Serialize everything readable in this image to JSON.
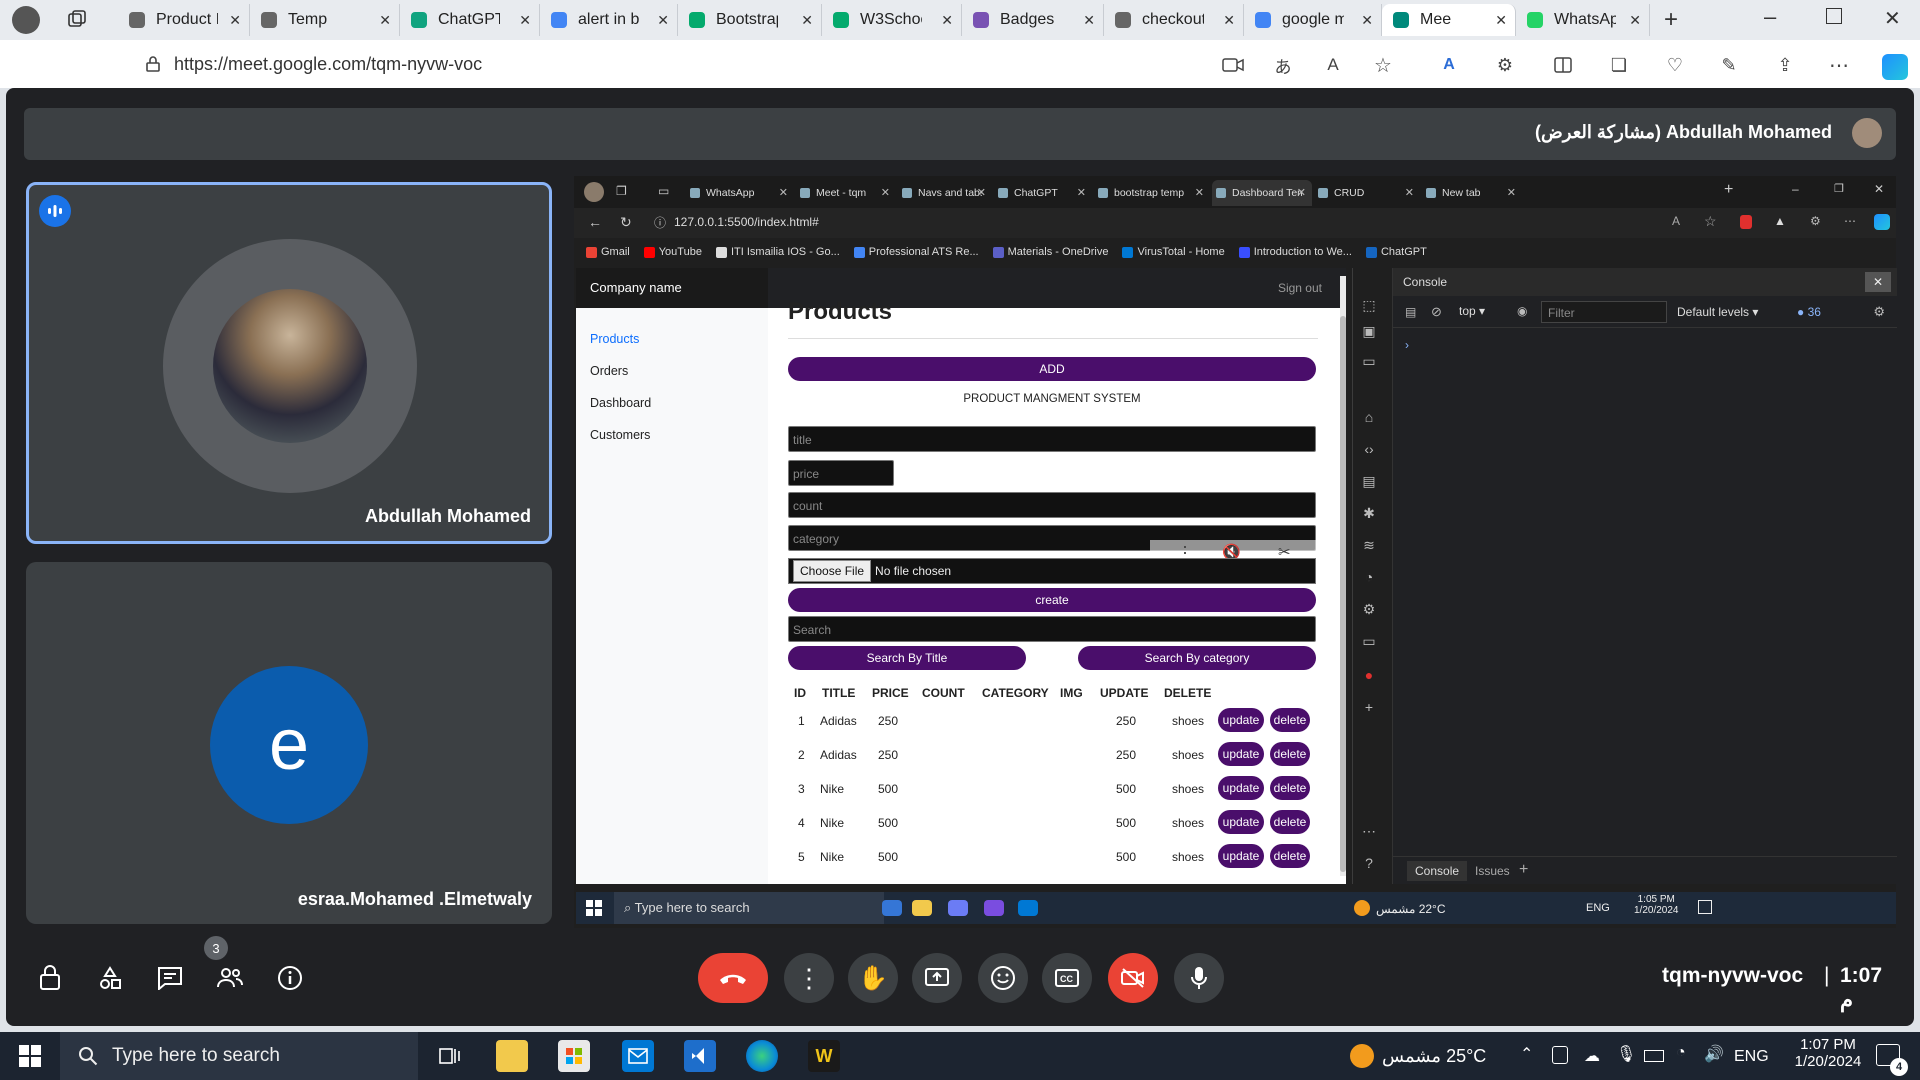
{
  "browser": {
    "tabs": [
      {
        "label": "Product I",
        "icon": "document-icon",
        "active": false
      },
      {
        "label": "Temp",
        "icon": "document-icon",
        "active": false
      },
      {
        "label": "ChatGPT",
        "icon": "chatgpt-icon",
        "active": false
      },
      {
        "label": "alert in b",
        "icon": "search-icon",
        "active": false
      },
      {
        "label": "Bootstrap",
        "icon": "w3schools-icon",
        "active": false
      },
      {
        "label": "W3Schoo",
        "icon": "w3schools-icon",
        "active": false
      },
      {
        "label": "Badges",
        "icon": "bootstrap-icon",
        "active": false
      },
      {
        "label": "checkout",
        "icon": "document-icon",
        "active": false
      },
      {
        "label": "google m",
        "icon": "search-icon",
        "active": false
      },
      {
        "label": "Mee",
        "icon": "meet-icon",
        "active": true
      },
      {
        "label": "WhatsAp",
        "icon": "whatsapp-icon",
        "active": false
      }
    ],
    "url": "https://meet.google.com/tqm-nyvw-voc"
  },
  "meet": {
    "presenter_title": "Abdullah Mohamed (مشاركة العرض)",
    "participants": [
      {
        "name": "Abdullah Mohamed",
        "speaking": true
      },
      {
        "name": "esraa.Mohamed .Elmetwaly",
        "initial": "e",
        "avatar_color": "#0b5cad"
      }
    ],
    "people_count": "3",
    "meeting_code": "tqm-nyvw-voc",
    "time": "1:07 م",
    "end_call_color": "#ea4335"
  },
  "shared": {
    "tabs": [
      {
        "label": "WhatsApp"
      },
      {
        "label": "Meet - tqm"
      },
      {
        "label": "Navs and tabs -"
      },
      {
        "label": "ChatGPT"
      },
      {
        "label": "bootstrap temp"
      },
      {
        "label": "Dashboard Tem"
      },
      {
        "label": "CRUD"
      },
      {
        "label": "New tab"
      }
    ],
    "url": "127.0.0.1:5500/index.html#",
    "bookmarks": [
      "Gmail",
      "YouTube",
      "ITI Ismailia IOS - Go...",
      "Professional ATS Re...",
      "Materials - OneDrive",
      "VirusTotal - Home",
      "Introduction to We...",
      "ChatGPT"
    ],
    "app": {
      "company": "Company name",
      "signout": "Sign out",
      "nav": [
        "Products",
        "Orders",
        "Dashboard",
        "Customers"
      ],
      "page_title": "Products",
      "add_label": "ADD",
      "subtitle": "PRODUCT MANGMENT SYSTEM",
      "placeholders": {
        "title": "title",
        "price": "price",
        "count": "count",
        "category": "category",
        "search": "Search"
      },
      "file_button": "Choose File",
      "file_status": "No file chosen",
      "create_label": "create",
      "search_title_label": "Search By Title",
      "search_category_label": "Search By category",
      "columns": [
        "ID",
        "TITLE",
        "PRICE",
        "COUNT",
        "CATEGORY",
        "IMG",
        "UPDATE",
        "DELETE"
      ],
      "rows": [
        {
          "id": "1",
          "title": "Adidas",
          "price": "250",
          "total": "250",
          "category": "shoes"
        },
        {
          "id": "2",
          "title": "Adidas",
          "price": "250",
          "total": "250",
          "category": "shoes"
        },
        {
          "id": "3",
          "title": "Nike",
          "price": "500",
          "total": "500",
          "category": "shoes"
        },
        {
          "id": "4",
          "title": "Nike",
          "price": "500",
          "total": "500",
          "category": "shoes"
        },
        {
          "id": "5",
          "title": "Nike",
          "price": "500",
          "total": "500",
          "category": "shoes"
        }
      ],
      "update_label": "update",
      "delete_label": "delete",
      "accent": "#4a0e6b"
    },
    "devtools": {
      "title": "Console",
      "context": "top",
      "filter_placeholder": "Filter",
      "levels": "Default levels",
      "issues_count": "36",
      "bottom_tabs": [
        "Console",
        "Issues"
      ]
    },
    "taskbar": {
      "search": "Type here to search",
      "weather": "22°C مشمس",
      "lang": "ENG",
      "time": "1:05 PM",
      "date": "1/20/2024"
    }
  },
  "taskbar": {
    "search": "Type here to search",
    "weather": "25°C مشمس",
    "lang": "ENG",
    "time": "1:07 PM",
    "date": "1/20/2024",
    "notifications": "4"
  }
}
